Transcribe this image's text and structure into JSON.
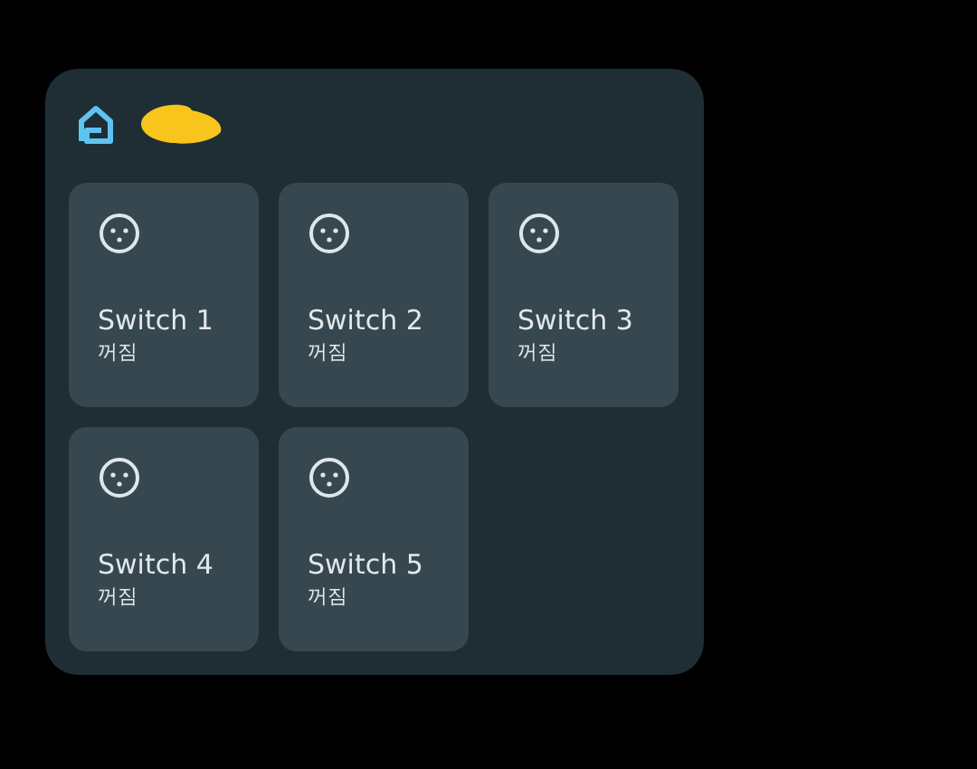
{
  "switches": [
    {
      "name": "Switch 1",
      "status": "꺼짐",
      "on": false
    },
    {
      "name": "Switch 2",
      "status": "꺼짐",
      "on": false
    },
    {
      "name": "Switch 3",
      "status": "꺼짐",
      "on": false
    },
    {
      "name": "Switch 4",
      "status": "꺼짐",
      "on": false
    },
    {
      "name": "Switch 5",
      "status": "꺼짐",
      "on": false
    }
  ]
}
